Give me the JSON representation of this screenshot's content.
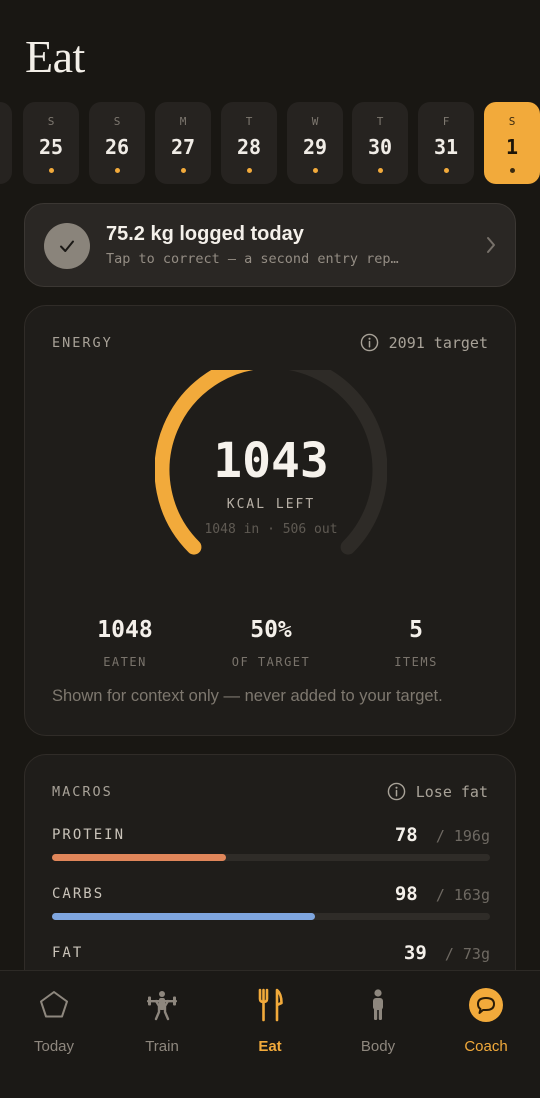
{
  "page": {
    "title": "Eat"
  },
  "days": [
    {
      "dow": "S",
      "num": "25",
      "dot": true
    },
    {
      "dow": "S",
      "num": "26",
      "dot": true
    },
    {
      "dow": "M",
      "num": "27",
      "dot": true
    },
    {
      "dow": "T",
      "num": "28",
      "dot": true
    },
    {
      "dow": "W",
      "num": "29",
      "dot": true
    },
    {
      "dow": "T",
      "num": "30",
      "dot": true
    },
    {
      "dow": "F",
      "num": "31",
      "dot": true
    },
    {
      "dow": "S",
      "num": "1",
      "dot": true,
      "active": true
    }
  ],
  "log_banner": {
    "title": "75.2 kg logged today",
    "subtitle": "Tap to correct — a second entry rep…"
  },
  "energy": {
    "label": "ENERGY",
    "target_text": "2091 target",
    "kcal_left": "1043",
    "unit": "KCAL LEFT",
    "breakdown": "1048 in · 506 out",
    "progress_fraction": 0.5,
    "stats": [
      {
        "value": "1048",
        "label": "EATEN"
      },
      {
        "value": "50%",
        "label": "OF TARGET"
      },
      {
        "value": "5",
        "label": "ITEMS"
      }
    ],
    "note": "Shown for context only — never added to your target."
  },
  "macros": {
    "label": "MACROS",
    "goal": "Lose fat",
    "items": [
      {
        "name": "PROTEIN",
        "current": "78",
        "sep": "/",
        "target": "196g",
        "fraction": 0.398,
        "color": "#e0865a"
      },
      {
        "name": "CARBS",
        "current": "98",
        "sep": "/",
        "target": "163g",
        "fraction": 0.601,
        "color": "#7fa6df"
      },
      {
        "name": "FAT",
        "current": "39",
        "sep": "/",
        "target": "73g",
        "fraction": 0.534,
        "color": "#e8c65a"
      }
    ]
  },
  "tabs": [
    {
      "label": "Today",
      "icon": "pentagon-icon"
    },
    {
      "label": "Train",
      "icon": "weightlifter-icon"
    },
    {
      "label": "Eat",
      "icon": "fork-knife-icon",
      "active": true
    },
    {
      "label": "Body",
      "icon": "person-icon"
    },
    {
      "label": "Coach",
      "icon": "chat-bubble-icon"
    }
  ],
  "colors": {
    "accent": "#f2aa3b",
    "background": "#191713",
    "card": "#1f1d1a"
  }
}
